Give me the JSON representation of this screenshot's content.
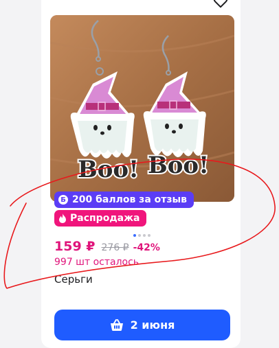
{
  "product": {
    "bonus_badge": "200 баллов за отзыв",
    "bonus_badge_letter": "Б",
    "sale_badge": "Распродажа",
    "price": "159 ₽",
    "old_price": "276 ₽",
    "discount": "-42%",
    "stock": "997 шт осталось",
    "title": "Серьги",
    "buy_button": "2 июня",
    "photo_text_left": "Boo!",
    "photo_text_right": "Boo!",
    "gallery": {
      "total": 4,
      "current": 1
    }
  },
  "icons": {
    "favorite": "heart-icon",
    "sale": "fire-icon",
    "buy": "basket-icon"
  },
  "colors": {
    "accent": "#1f5cff",
    "price": "#e0157b",
    "bonus_badge": "#5b3df5",
    "sale_badge": "#f0157c",
    "annotation": "#e8191c"
  }
}
